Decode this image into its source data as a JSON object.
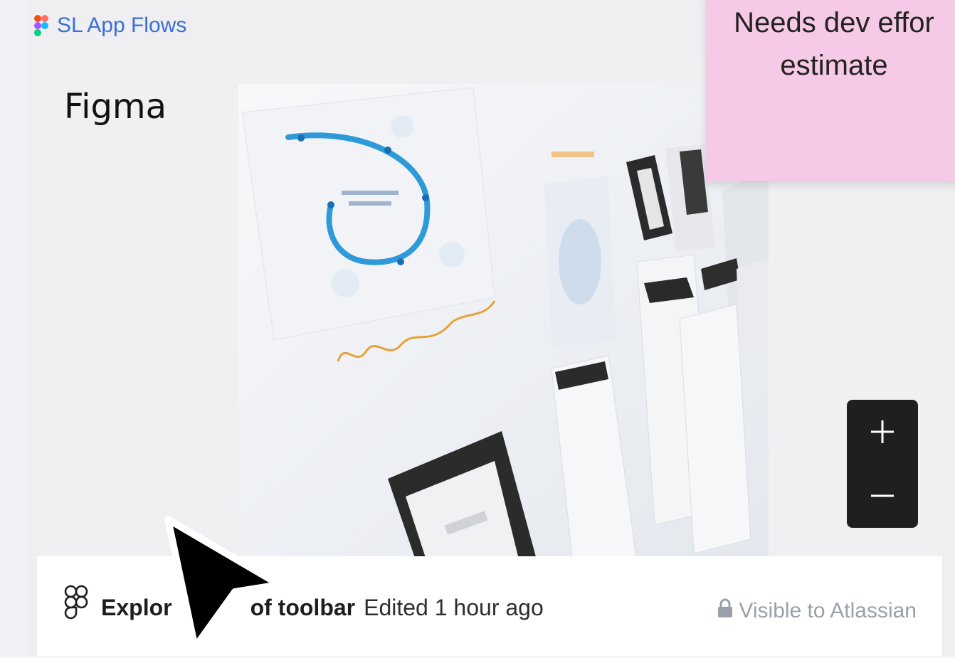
{
  "embed": {
    "link_label": "SL App Flows",
    "preview_title": "Figma",
    "file_name": "Explor",
    "file_name_tail": "of toolbar",
    "edited_text": "Edited 1 hour ago",
    "visibility_label": "Visible to Atlassian"
  },
  "sticky_note": {
    "line1": "Needs dev effor",
    "line2": "estimate",
    "color": "#f6c9e7"
  },
  "zoom_controls": {
    "zoom_in": "+",
    "zoom_out": "−"
  },
  "icons": {
    "link_icon": "figma-logo-icon",
    "file_icon": "figma-logo-outline-icon",
    "lock_icon": "lock-icon",
    "cursor": "arrow-cursor-icon"
  },
  "colors": {
    "link": "#3a6ed8",
    "zoom_bg": "#1f1f1f",
    "muted": "#9aa0aa"
  }
}
